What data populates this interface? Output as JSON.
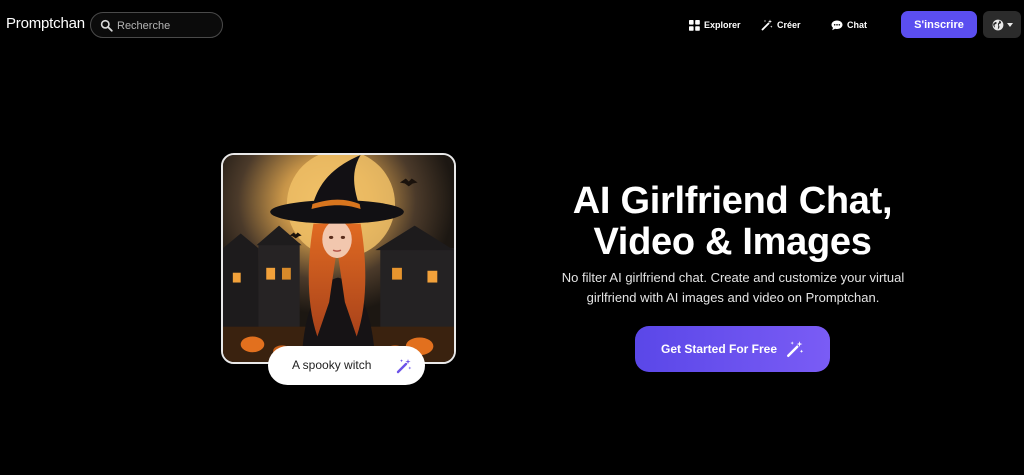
{
  "navbar": {
    "brand": "Promptchan",
    "search": {
      "placeholder": "Recherche",
      "value": ""
    },
    "links": [
      {
        "label": "Explorer",
        "icon": "grid-icon"
      },
      {
        "label": "Créer",
        "icon": "magic-wand-icon"
      },
      {
        "label": "Chat",
        "icon": "chat-bubble-icon"
      }
    ],
    "signup_label": "S'inscrire",
    "language_icon": "globe-icon",
    "accent_color": "#5b4ef0"
  },
  "hero": {
    "image_prompt": "A spooky witch",
    "title_line1": "AI Girlfriend Chat,",
    "title_line2": "Video & Images",
    "subtitle_line1": "No filter AI girlfriend chat. Create and customize your virtual",
    "subtitle_line2": "girlfriend with AI images and video on Promptchan.",
    "cta_label": "Get Started For Free",
    "cta_icon": "magic-wand-icon"
  }
}
